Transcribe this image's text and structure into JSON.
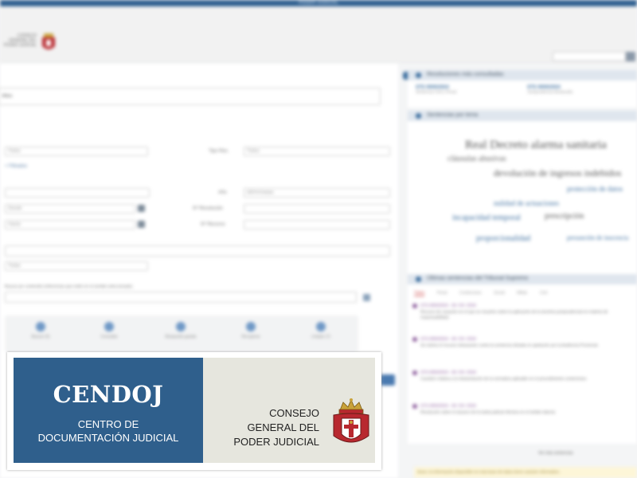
{
  "banner": {
    "title": "CENDOJ",
    "subtitle_line1": "CENTRO DE",
    "subtitle_line2": "DOCUMENTACIÓN JUDICIAL",
    "org_line1": "CONSEJO",
    "org_line2": "GENERAL DEL",
    "org_line3": "PODER JUDICIAL"
  },
  "colors": {
    "banner_blue": "#2f5f8c",
    "banner_grey": "#e6e6de",
    "accent": "#3b6d9e"
  },
  "icons": [
    "crest-icon",
    "calendar-icon",
    "search-icon",
    "tag-icon"
  ],
  "background_page": {
    "top_stripe_title": "PODER JUDICIAL",
    "search_placeholder": "",
    "search_field_value": "Altos",
    "form": {
      "select_1": "Todos",
      "select_2_label": "Tipo Res.",
      "select_2": "Todos",
      "checkbox_label": "+ Filtrados",
      "date_label": "Año",
      "date_placeholder": "dd/mm/aaaa",
      "from_placeholder": "Desde",
      "to_placeholder": "Hasta",
      "num_resolution_label": "Nº Resolución",
      "num_appeal_label": "Nº Recurso",
      "select_3": "Todas",
      "free_text_label": "Buscar por contenido (referencias que estén en el sentido seleccionado)"
    },
    "toolbar_items": [
      "Buscar (5)",
      "Consultar",
      "Búsqueda guiada",
      "Recuperar",
      "Limpiar (7)"
    ],
    "right_panels": {
      "recent_title": "Resoluciones más consultadas",
      "recent_items": [
        {
          "num": "STS 0000/2024",
          "sub": "Sentencia Civil y Penal"
        },
        {
          "num": "STS 0000/2024",
          "sub": "Jurisprudencia destacada"
        }
      ],
      "topics_title": "Sentencias por tema",
      "cloud_words": [
        "Real Decreto alarma sanitaria",
        "cláusulas abusivas",
        "devolución de ingresos indebidos",
        "protección de datos",
        "nulidad de actuaciones",
        "incapacidad temporal",
        "prescripción",
        "proporcionalidad",
        "presunción de inocencia"
      ],
      "news_title": "Últimas sentencias del Tribunal Supremo",
      "news_tabs": [
        "Todos",
        "Penal",
        "Contencioso",
        "Social",
        "Militar",
        "Civil"
      ],
      "news_items": [
        {
          "title": "STS 0000/2024 - 00 / 00 / 2024",
          "text": "Recurso de casación en el que se resuelve sobre la aplicación de la doctrina jurisprudencial en materia de responsabilidad."
        },
        {
          "title": "STS 0000/2024 - 00 / 00 / 2024",
          "text": "Se estima el recurso interpuesto contra la sentencia dictada en apelación por la Audiencia Provincial."
        },
        {
          "title": "STS 0000/2024 - 00 / 00 / 2024",
          "text": "Cuestión relativa a la interpretación de la normativa aplicable en el procedimiento contencioso."
        },
        {
          "title": "STS 0000/2024 - 00 / 00 / 2024",
          "text": "Resolución sobre el alcance de la tutela judicial efectiva en el ámbito laboral."
        }
      ],
      "more_link": "Ver más sentencias",
      "notice": "Aviso: la información disponible en esta base de datos tiene carácter informativo."
    }
  }
}
